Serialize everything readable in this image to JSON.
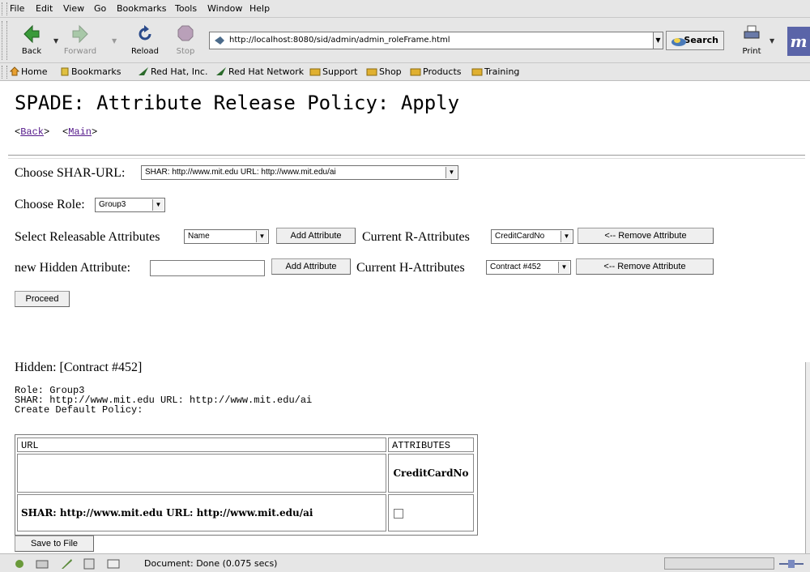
{
  "menu": [
    "File",
    "Edit",
    "View",
    "Go",
    "Bookmarks",
    "Tools",
    "Window",
    "Help"
  ],
  "nav": {
    "back": "Back",
    "forward": "Forward",
    "reload": "Reload",
    "stop": "Stop",
    "url": "http://localhost:8080/sid/admin/admin_roleFrame.html",
    "search": "Search",
    "print": "Print"
  },
  "bookmarks": [
    "Home",
    "Bookmarks",
    "Red Hat, Inc.",
    "Red Hat Network",
    "Support",
    "Shop",
    "Products",
    "Training"
  ],
  "page": {
    "title": "SPADE: Attribute Release Policy: Apply",
    "back_link": "Back",
    "main_link": "Main",
    "choose_shar_label": "Choose SHAR-URL:",
    "shar_selected": "SHAR: http://www.mit.edu URL: http://www.mit.edu/ai",
    "choose_role_label": "Choose Role:",
    "role_selected": "Group3",
    "select_releasable_label": "Select Releasable Attributes",
    "releasable_selected": "Name",
    "add_attribute": "Add Attribute",
    "current_r_label": "Current R-Attributes",
    "r_attr_selected": "CreditCardNo",
    "remove_attribute": "<-- Remove Attribute",
    "new_hidden_label": "new Hidden Attribute:",
    "hidden_input_value": "",
    "current_h_label": "Current H-Attributes",
    "h_attr_selected": "Contract #452",
    "proceed": "Proceed",
    "hidden_line": "Hidden: [Contract #452]",
    "role_line": "Role: Group3",
    "shar_line": "SHAR: http://www.mit.edu URL: http://www.mit.edu/ai",
    "create_default": "Create Default Policy:",
    "table": {
      "col_url": "URL",
      "col_attributes": "ATTRIBUTES",
      "attr_header": "CreditCardNo",
      "row_url": "SHAR: http://www.mit.edu URL: http://www.mit.edu/ai",
      "row_checked": false
    },
    "save_to_file": "Save to File"
  },
  "status": {
    "text": "Document: Done (0.075 secs)"
  }
}
